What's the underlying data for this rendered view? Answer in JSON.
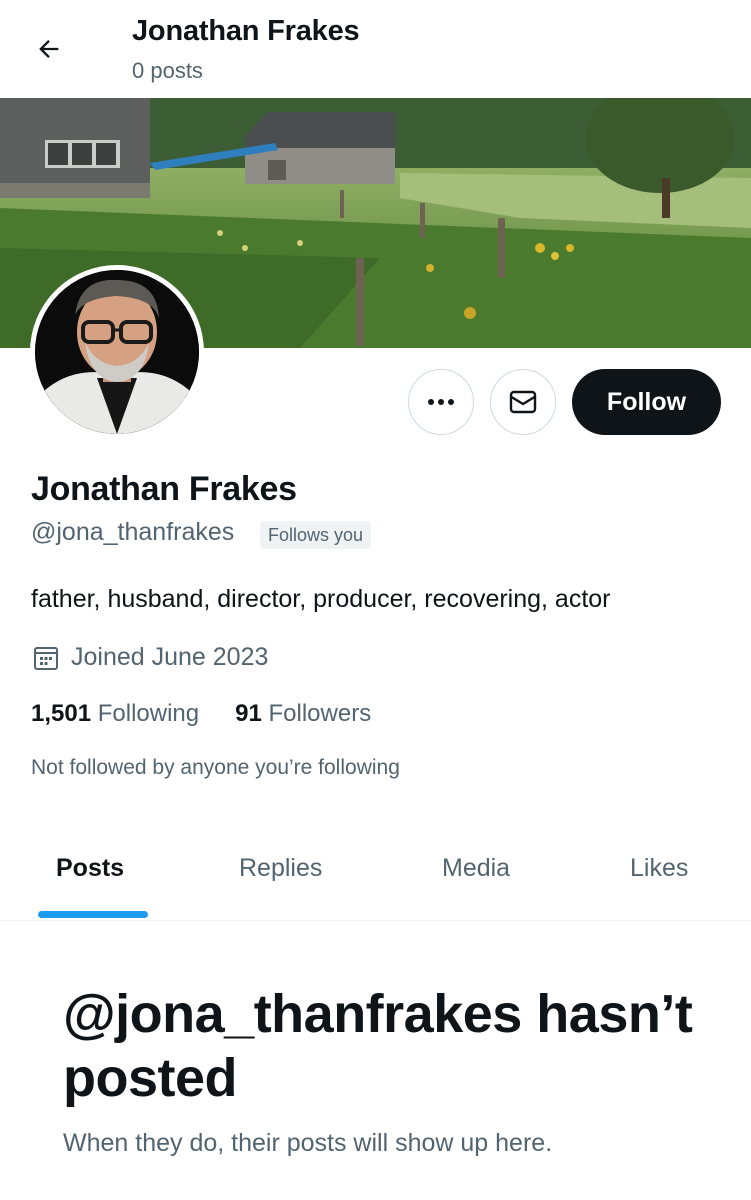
{
  "header": {
    "name": "Jonathan Frakes",
    "post_count": "0 posts",
    "back_icon": "arrow-left-icon"
  },
  "profile": {
    "display_name": "Jonathan Frakes",
    "handle": "@jona_thanfrakes",
    "follows_you_badge": "Follows you",
    "bio": "father, husband, director, producer, recovering, actor",
    "joined": "Joined June 2023",
    "joined_icon": "calendar-icon",
    "following_count": "1,501",
    "following_label": "Following",
    "followers_count": "91",
    "followers_label": "Followers",
    "not_followed_text": "Not followed by anyone you’re following"
  },
  "actions": {
    "more_icon": "more-dots-icon",
    "message_icon": "envelope-icon",
    "follow_label": "Follow"
  },
  "tabs": [
    {
      "label": "Posts",
      "active": true
    },
    {
      "label": "Replies",
      "active": false
    },
    {
      "label": "Media",
      "active": false
    },
    {
      "label": "Likes",
      "active": false
    }
  ],
  "empty_state": {
    "title": "@jona_thanfrakes hasn’t posted",
    "subtitle": "When they do, their posts will show up here."
  },
  "colors": {
    "text_primary": "#0f1419",
    "text_secondary": "#536471",
    "accent": "#1d9bf0",
    "follow_button_bg": "#0f1419"
  }
}
